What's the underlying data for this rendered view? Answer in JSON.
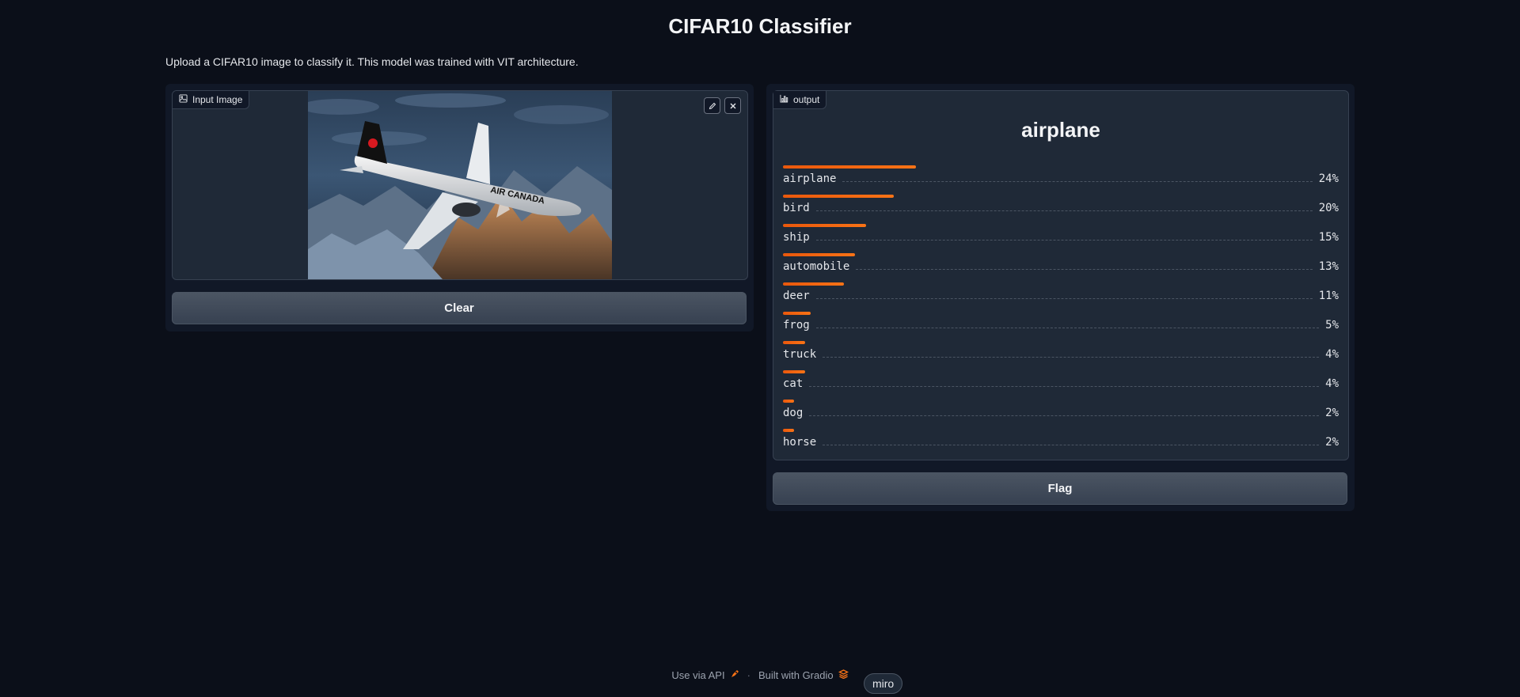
{
  "header": {
    "title": "CIFAR10 Classifier",
    "description": "Upload a CIFAR10 image to classify it. This model was trained with VIT architecture."
  },
  "input": {
    "label": "Input Image",
    "label_icon": "image-icon",
    "tools": [
      "edit-icon",
      "close-icon"
    ]
  },
  "buttons": {
    "clear": "Clear",
    "flag": "Flag"
  },
  "output": {
    "label": "output",
    "label_icon": "chart-icon",
    "top_class": "airplane",
    "confidences": [
      {
        "label": "airplane",
        "percent_text": "24%",
        "value": 0.24
      },
      {
        "label": "bird",
        "percent_text": "20%",
        "value": 0.2
      },
      {
        "label": "ship",
        "percent_text": "15%",
        "value": 0.15
      },
      {
        "label": "automobile",
        "percent_text": "13%",
        "value": 0.13
      },
      {
        "label": "deer",
        "percent_text": "11%",
        "value": 0.11
      },
      {
        "label": "frog",
        "percent_text": "5%",
        "value": 0.05
      },
      {
        "label": "truck",
        "percent_text": "4%",
        "value": 0.04
      },
      {
        "label": "cat",
        "percent_text": "4%",
        "value": 0.04
      },
      {
        "label": "dog",
        "percent_text": "2%",
        "value": 0.02
      },
      {
        "label": "horse",
        "percent_text": "2%",
        "value": 0.02
      }
    ]
  },
  "footer": {
    "api": "Use via API",
    "separator": "·",
    "built": "Built with Gradio",
    "badge": "miro"
  },
  "colors": {
    "background": "#0b0f19",
    "accent": "#f97316",
    "panel": "#1f2937"
  }
}
